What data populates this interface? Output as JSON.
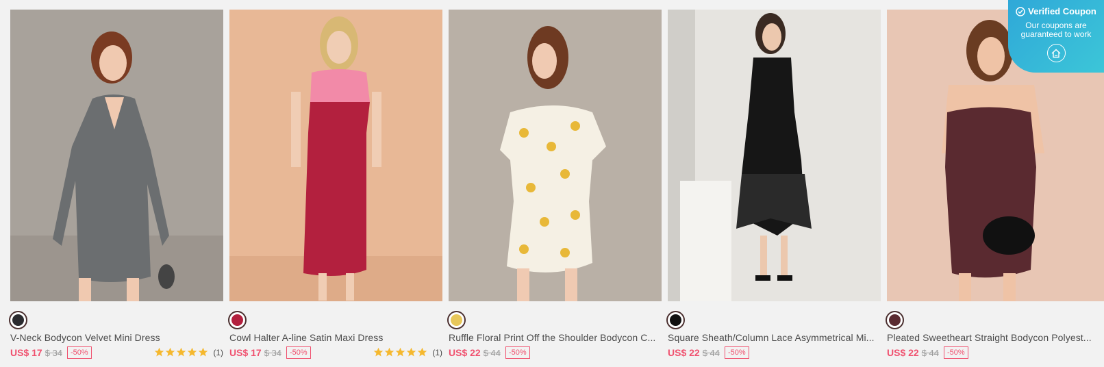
{
  "products": [
    {
      "name": "V-Neck Bodycon Velvet Mini Dress",
      "price": "US$ 17",
      "original_price": "$ 34",
      "discount": "-50%",
      "rating_count": "(1)",
      "stars": 5,
      "swatch_color": "#2b2b2f"
    },
    {
      "name": "Cowl Halter A-line Satin Maxi Dress",
      "price": "US$ 17",
      "original_price": "$ 34",
      "discount": "-50%",
      "rating_count": "(1)",
      "stars": 5,
      "swatch_color": "#b3203e"
    },
    {
      "name": "Ruffle Floral Print Off the Shoulder Bodycon C...",
      "price": "US$ 22",
      "original_price": "$ 44",
      "discount": "-50%",
      "swatch_color": "#e8c75a"
    },
    {
      "name": "Square Sheath/Column Lace Asymmetrical Mi...",
      "price": "US$ 22",
      "original_price": "$ 44",
      "discount": "-50%",
      "swatch_color": "#111111"
    },
    {
      "name": "Pleated Sweetheart Straight Bodycon Polyest...",
      "price": "US$ 22",
      "original_price": "$ 44",
      "discount": "-50%",
      "swatch_color": "#5a2a30"
    }
  ],
  "coupon": {
    "title": "Verified Coupon",
    "line1": "Our coupons are",
    "line2": "guaranteed to work"
  },
  "colors": {
    "accent": "#f0506e",
    "coupon_bg": "#35b8d8",
    "star": "#f5b82e"
  }
}
